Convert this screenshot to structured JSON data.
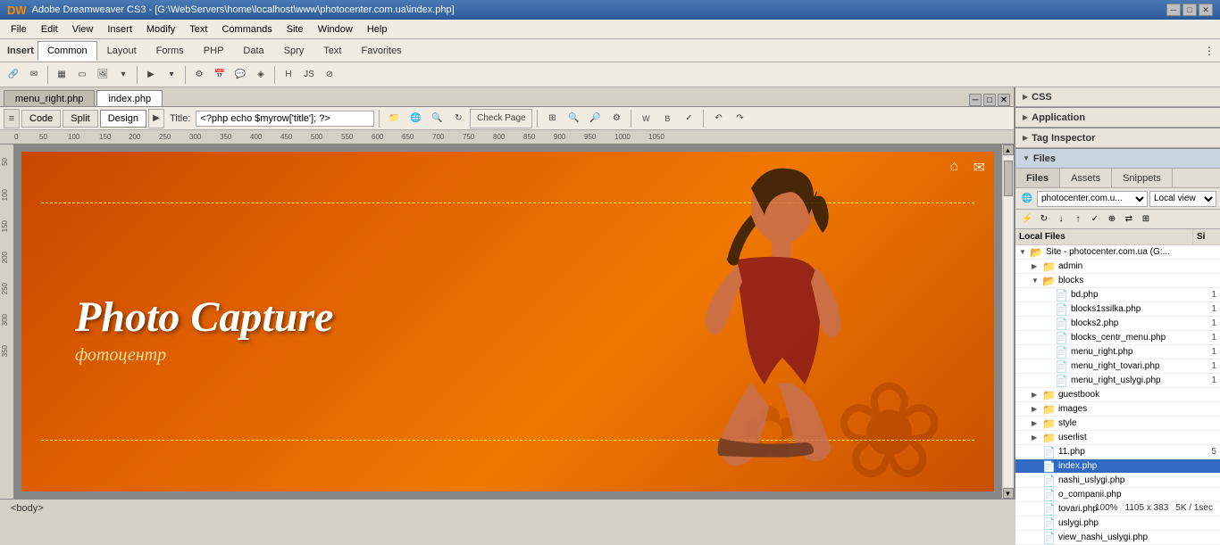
{
  "titlebar": {
    "title": "Adobe Dreamweaver CS3 - [G:\\WebServers\\home\\localhost\\www\\photocenter.com.ua\\index.php]",
    "icon": "dw-icon",
    "controls": [
      "minimize",
      "maximize",
      "close"
    ]
  },
  "menubar": {
    "items": [
      "File",
      "Edit",
      "View",
      "Insert",
      "Modify",
      "Text",
      "Commands",
      "Site",
      "Window",
      "Help"
    ]
  },
  "insert_toolbar": {
    "label": "Insert",
    "tabs": [
      "Common",
      "Layout",
      "Forms",
      "PHP",
      "Data",
      "Spry",
      "Text",
      "Favorites"
    ]
  },
  "doc_tabs": {
    "tabs": [
      "menu_right.php",
      "index.php"
    ],
    "active": "index.php"
  },
  "doc_toolbar": {
    "view_buttons": [
      "Code",
      "Split",
      "Design"
    ],
    "active_view": "Design",
    "title_label": "Title:",
    "title_value": "<?php echo $myrow['title']; ?>"
  },
  "canvas": {
    "zoom": "100%",
    "dimensions": "1105 x 383",
    "filesize": "5K / 1sec"
  },
  "banner": {
    "title": "Photo Capture",
    "subtitle": "фотоцентр",
    "bg_color1": "#c84800",
    "bg_color2": "#e87000"
  },
  "right_panel": {
    "sections": {
      "css": {
        "label": "CSS",
        "collapsed": true
      },
      "application": {
        "label": "Application",
        "collapsed": true
      },
      "tag_inspector": {
        "label": "Tag Inspector",
        "collapsed": true
      },
      "files": {
        "label": "Files",
        "collapsed": false
      }
    },
    "files_tabs": [
      "Files",
      "Assets",
      "Snippets"
    ],
    "active_tab": "Files",
    "site_name": "photocenter.com.u...",
    "view": "Local view",
    "local_files_header": "Local Files",
    "size_header": "Si",
    "tree": [
      {
        "id": "root",
        "name": "Site - photocenter.com.ua (G:...",
        "type": "site",
        "indent": 0,
        "expanded": true,
        "size": ""
      },
      {
        "id": "admin",
        "name": "admin",
        "type": "folder",
        "indent": 1,
        "expanded": false,
        "size": ""
      },
      {
        "id": "blocks",
        "name": "blocks",
        "type": "folder",
        "indent": 1,
        "expanded": true,
        "size": ""
      },
      {
        "id": "bd.php",
        "name": "bd.php",
        "type": "file",
        "indent": 2,
        "expanded": false,
        "size": "1"
      },
      {
        "id": "blocks1ssilka.php",
        "name": "blocks1ssilka.php",
        "type": "file",
        "indent": 2,
        "expanded": false,
        "size": "1"
      },
      {
        "id": "blocks2.php",
        "name": "blocks2.php",
        "type": "file",
        "indent": 2,
        "expanded": false,
        "size": "1"
      },
      {
        "id": "blocks_centr_menu.php",
        "name": "blocks_centr_menu.php",
        "type": "file",
        "indent": 2,
        "expanded": false,
        "size": "1"
      },
      {
        "id": "menu_right.php",
        "name": "menu_right.php",
        "type": "file",
        "indent": 2,
        "expanded": false,
        "size": "1"
      },
      {
        "id": "menu_right_tovari.php",
        "name": "menu_right_tovari.php",
        "type": "file",
        "indent": 2,
        "expanded": false,
        "size": "1"
      },
      {
        "id": "menu_right_uslygi.php",
        "name": "menu_right_uslygi.php",
        "type": "file",
        "indent": 2,
        "expanded": false,
        "size": "1"
      },
      {
        "id": "guestbook",
        "name": "guestbook",
        "type": "folder",
        "indent": 1,
        "expanded": false,
        "size": ""
      },
      {
        "id": "images",
        "name": "images",
        "type": "folder",
        "indent": 1,
        "expanded": false,
        "size": ""
      },
      {
        "id": "style",
        "name": "style",
        "type": "folder",
        "indent": 1,
        "expanded": false,
        "size": ""
      },
      {
        "id": "userlist",
        "name": "userlist",
        "type": "folder",
        "indent": 1,
        "expanded": false,
        "size": ""
      },
      {
        "id": "11.php",
        "name": "11.php",
        "type": "file",
        "indent": 1,
        "expanded": false,
        "size": "5"
      },
      {
        "id": "index.php",
        "name": "index.php",
        "type": "file",
        "indent": 1,
        "expanded": false,
        "size": "",
        "selected": true
      },
      {
        "id": "nashi_uslygi.php",
        "name": "nashi_uslygi.php",
        "type": "file",
        "indent": 1,
        "expanded": false,
        "size": ""
      },
      {
        "id": "o_companii.php",
        "name": "o_companii.php",
        "type": "file",
        "indent": 1,
        "expanded": false,
        "size": ""
      },
      {
        "id": "tovari.php",
        "name": "tovari.php",
        "type": "file",
        "indent": 1,
        "expanded": false,
        "size": ""
      },
      {
        "id": "uslygi.php",
        "name": "uslygi.php",
        "type": "file",
        "indent": 1,
        "expanded": false,
        "size": ""
      },
      {
        "id": "view_nashi_uslygi.php",
        "name": "view_nashi_uslygi.php",
        "type": "file",
        "indent": 1,
        "expanded": false,
        "size": ""
      }
    ]
  },
  "statusbar": {
    "tag": "<body>",
    "zoom": "100%",
    "dimensions": "1105 x 383",
    "filesize": "5K / 1sec"
  }
}
